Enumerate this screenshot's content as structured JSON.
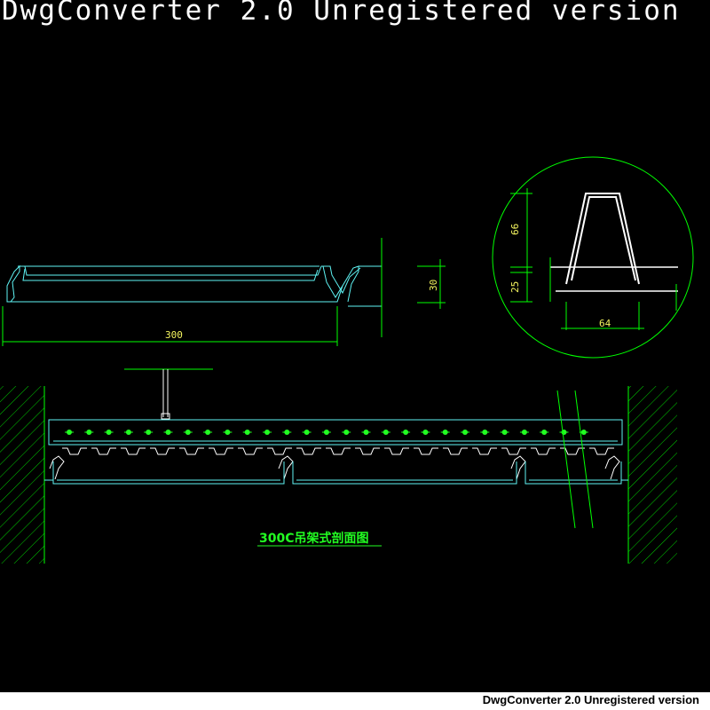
{
  "watermark": "DwgConverter 2.0 Unregistered version",
  "footer": "DwgConverter 2.0 Unregistered version",
  "dimensions": {
    "panel_width": "300",
    "panel_height": "30",
    "detail_top": "66",
    "detail_bottom": "25",
    "detail_width": "64"
  },
  "caption": "300C吊架式剖面图",
  "colors": {
    "background": "#000000",
    "cyan": "#5ff5f5",
    "green": "#00ff00",
    "white": "#ffffff",
    "yellow": "#f5f55f",
    "bright_green": "#22ff22"
  }
}
